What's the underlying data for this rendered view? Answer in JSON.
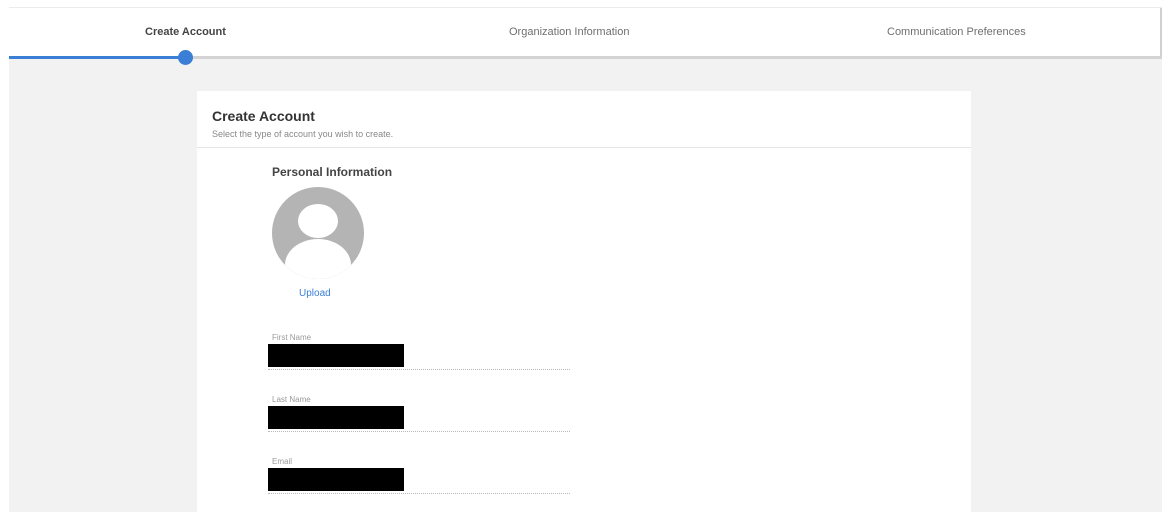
{
  "stepper": {
    "steps": [
      {
        "label": "Create Account",
        "active": true
      },
      {
        "label": "Organization Information",
        "active": false
      },
      {
        "label": "Communication Preferences",
        "active": false
      }
    ],
    "progress_color": "#3a7fd5",
    "current_step": 1
  },
  "card": {
    "title": "Create Account",
    "subtitle": "Select the type of account you wish to create."
  },
  "personal": {
    "section_title": "Personal Information",
    "avatar_icon": "user-avatar-icon",
    "upload_label": "Upload"
  },
  "fields": {
    "first_name_label": "First Name",
    "last_name_label": "Last Name",
    "email_label": "Email"
  }
}
